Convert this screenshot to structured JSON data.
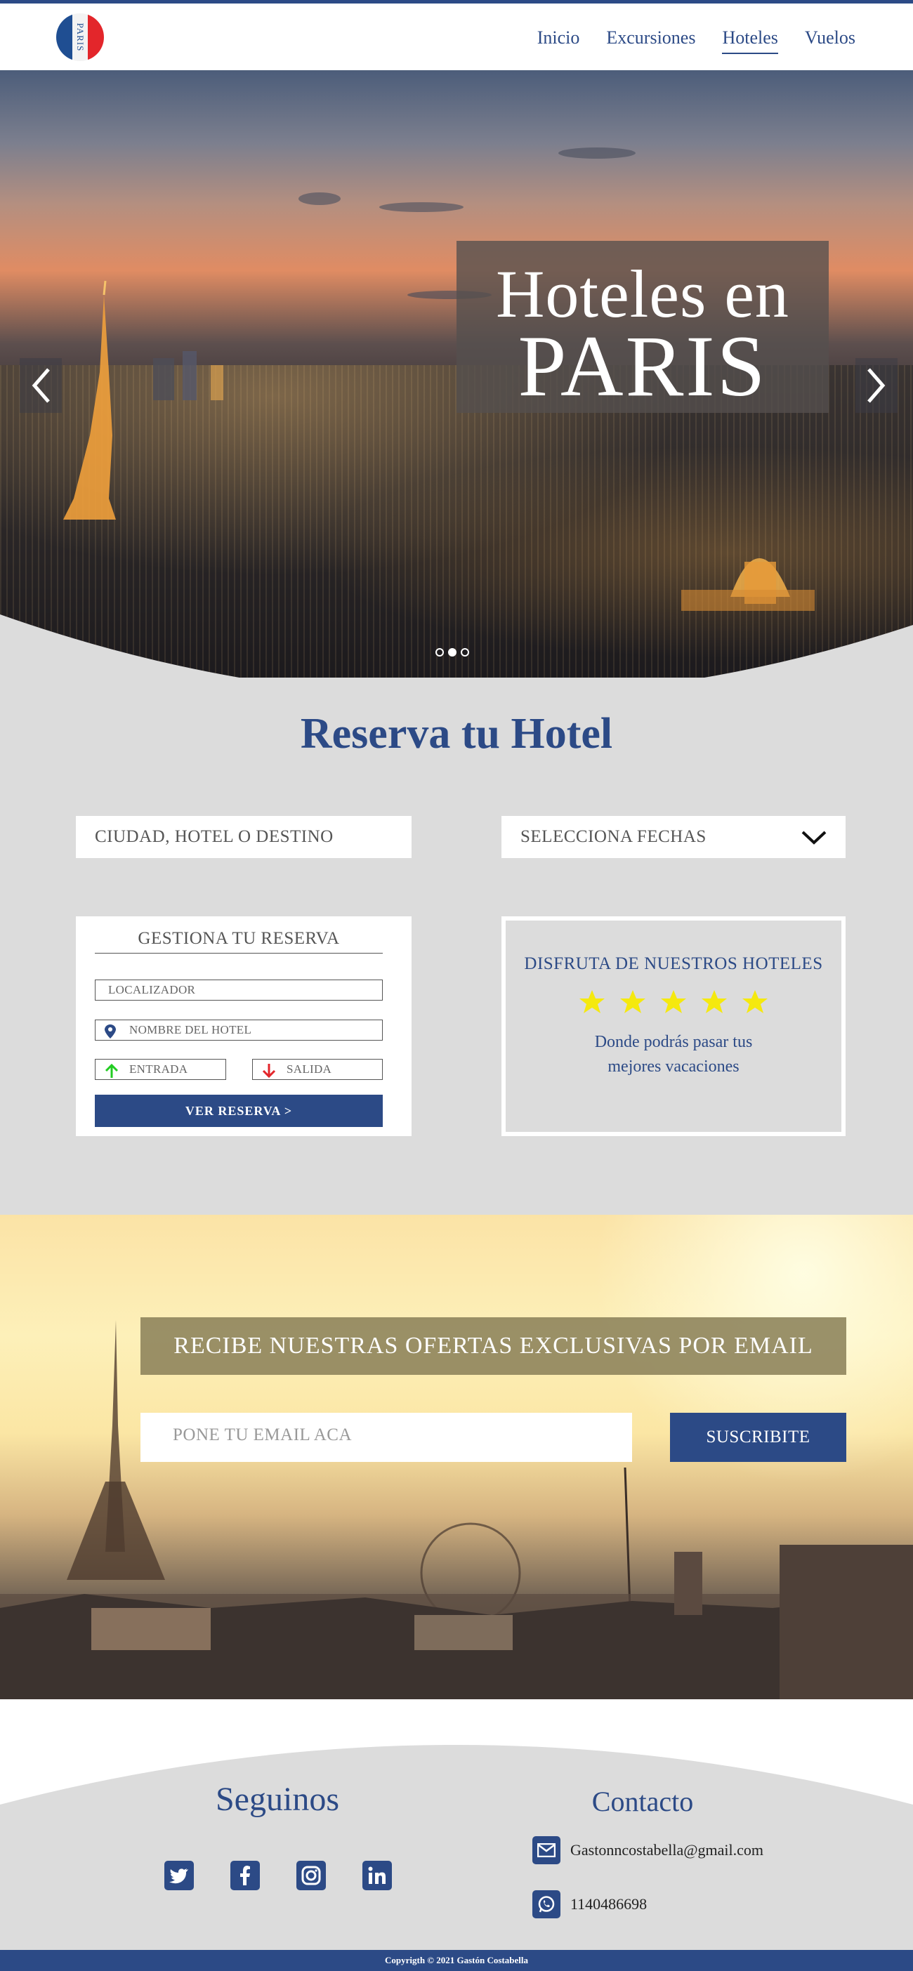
{
  "brand": {
    "logo_text": "PARIS"
  },
  "nav": {
    "items": [
      "Inicio",
      "Excursiones",
      "Hoteles",
      "Vuelos"
    ],
    "active": "Hoteles"
  },
  "hero": {
    "line1": "Hoteles en",
    "line2": "PARIS",
    "slides": 3,
    "active_slide": 2
  },
  "booking": {
    "title": "Reserva tu Hotel",
    "destination_placeholder": "CIUDAD, HOTEL O DESTINO",
    "dates_placeholder": "SELECCIONA FECHAS"
  },
  "manage": {
    "title": "GESTIONA TU RESERVA",
    "locator": "LOCALIZADOR",
    "hotel_name": "NOMBRE DEL HOTEL",
    "checkin": "ENTRADA",
    "checkout": "SALIDA",
    "button": "VER RESERVA >"
  },
  "enjoy": {
    "title": "DISFRUTA DE NUESTROS HOTELES",
    "rating": 5,
    "text_line1": "Donde podrás pasar tus",
    "text_line2": "mejores vacaciones"
  },
  "newsletter": {
    "title": "RECIBE NUESTRAS OFERTAS EXCLUSIVAS POR EMAIL",
    "email_placeholder": "PONE TU EMAIL ACA",
    "button": "SUSCRIBITE"
  },
  "footer": {
    "follow_title": "Seguinos",
    "social": [
      "twitter-icon",
      "facebook-icon",
      "instagram-icon",
      "linkedin-icon"
    ],
    "contact_title": "Contacto",
    "email": "Gastonncostabella@gmail.com",
    "phone": "1140486698",
    "copyright": "Copyrigth  ©  2021  Gastón Costabella"
  },
  "colors": {
    "primary": "#2c4a86",
    "star": "#f5e90e",
    "up": "#22cc22",
    "down": "#e3262b"
  }
}
